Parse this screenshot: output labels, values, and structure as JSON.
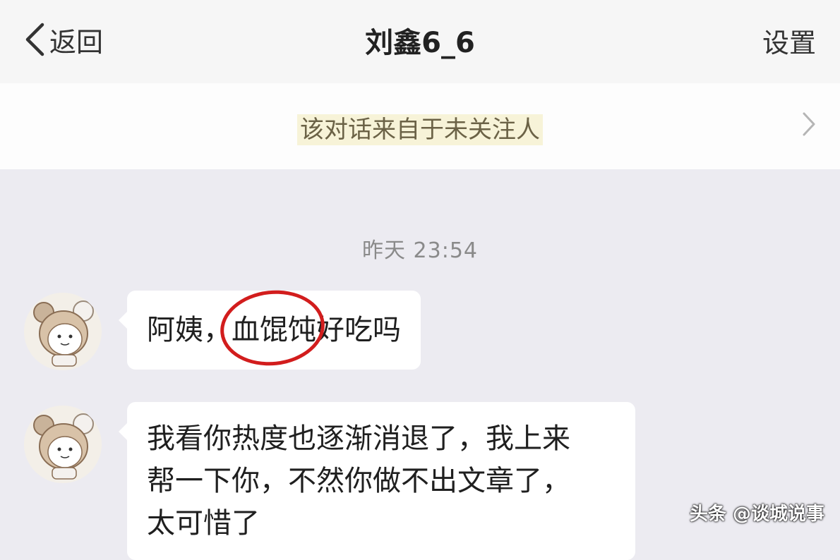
{
  "header": {
    "back_label": "返回",
    "title": "刘鑫6_6",
    "settings_label": "设置"
  },
  "notice": {
    "text": "该对话来自于未关注人"
  },
  "conversation": {
    "timestamp": "昨天 23:54",
    "messages": [
      {
        "before": "阿姨，",
        "highlight": "血馄饨",
        "after": "好吃吗"
      },
      {
        "lines": [
          "我看你热度也逐渐消退了，我上来",
          "帮一下你，不然你做不出文章了，",
          "太可惜了"
        ]
      }
    ]
  },
  "watermark": "头条 @谈城说事",
  "colors": {
    "highlight_circle": "#d21d1d",
    "notice_highlight": "#f7f3d8",
    "chat_background": "#ecebf1"
  },
  "icons": {
    "back": "chevron-left-icon",
    "notice": "chevron-right-icon",
    "avatar": "bear-avatar-icon"
  }
}
